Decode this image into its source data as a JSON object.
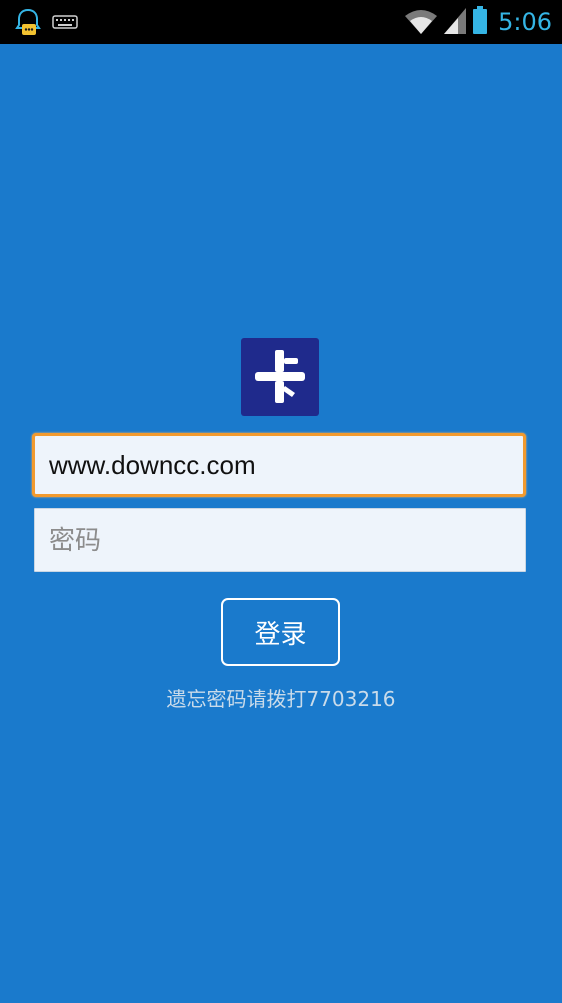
{
  "status_bar": {
    "time": "5:06",
    "icons": [
      "notification-agent-icon",
      "keyboard-icon",
      "wifi-icon",
      "signal-icon",
      "battery-icon"
    ],
    "time_color": "#35b5e5"
  },
  "login": {
    "logo_icon": "card-logo-icon",
    "username_value": "www.downcc.com",
    "password_placeholder": "密码",
    "login_button_label": "登录",
    "forgot_hint": "遗忘密码请拨打7703216"
  },
  "colors": {
    "background": "#1a7acc",
    "logo_bg": "#1f2a8c",
    "focus_border": "#f29a2e"
  }
}
